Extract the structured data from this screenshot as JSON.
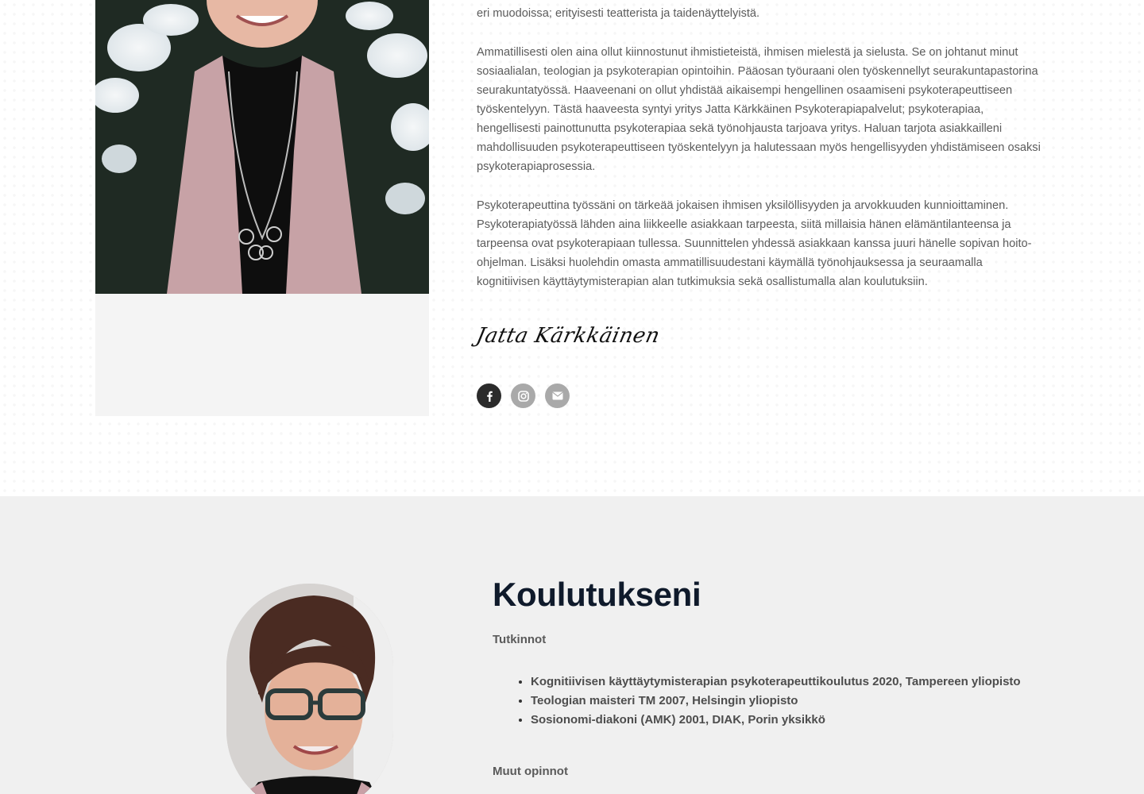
{
  "about": {
    "paragraphs": [
      "eri muodoissa; erityisesti teatterista ja taidenäyttelyistä.",
      "Ammatillisesti olen aina ollut kiinnostunut ihmistieteistä, ihmisen mielestä ja sielusta. Se on johtanut minut sosiaalialan, teologian ja psykoterapian opintoihin. Pääosan työuraani olen työskennellyt seurakuntapastorina seurakuntatyössä.  Haaveenani on ollut yhdistää aikaisempi hengellinen osaamiseni psykoterapeuttiseen työskentelyyn. Tästä haaveesta syntyi yritys Jatta Kärkkäinen Psykoterapiapalvelut; psykoterapiaa, hengellisesti painottunutta psykoterapiaa sekä työnohjausta tarjoava yritys.  Haluan tarjota asiakkailleni mahdollisuuden psykoterapeuttiseen työskentelyyn ja halutessaan myös hengellisyyden yhdistämiseen osaksi psykoterapiaprosessia.",
      "Psykoterapeuttina työssäni on tärkeää jokaisen ihmisen yksilöllisyyden ja arvokkuuden kunnioittaminen. Psykoterapiatyössä lähden aina liikkeelle asiakkaan tarpeesta, siitä millaisia hänen elämäntilanteensa ja tarpeensa ovat psykoterapiaan tullessa. Suunnittelen yhdessä asiakkaan kanssa juuri hänelle sopivan hoito-ohjelman. Lisäksi huolehdin omasta ammatillisuudestani käymällä työnohjauksessa ja seuraamalla kognitiivisen käyttäytymisterapian alan tutkimuksia sekä osallistumalla alan koulutuksiin."
    ],
    "signature": "Jatta Kärkkäinen",
    "social": [
      {
        "icon": "facebook-icon",
        "color": "#2b2b2b"
      },
      {
        "icon": "instagram-icon",
        "color": "#a9a9a9"
      },
      {
        "icon": "envelope-icon",
        "color": "#a9a9a9"
      }
    ]
  },
  "education": {
    "title": "Koulutukseni",
    "degrees_heading": "Tutkinnot",
    "degrees": [
      "Kognitiivisen käyttäytymisterapian psykoterapeuttikoulutus 2020, Tampereen yliopisto",
      "Teologian maisteri TM 2007, Helsingin yliopisto",
      "Sosionomi-diakoni (AMK) 2001, DIAK, Porin yksikkö"
    ],
    "other_heading": "Muut opinnot"
  },
  "colors": {
    "heading": "#0f1a2b",
    "section_bg": "#f0f0f0",
    "social_dark": "#2b2b2b",
    "social_grey": "#a9a9a9"
  }
}
